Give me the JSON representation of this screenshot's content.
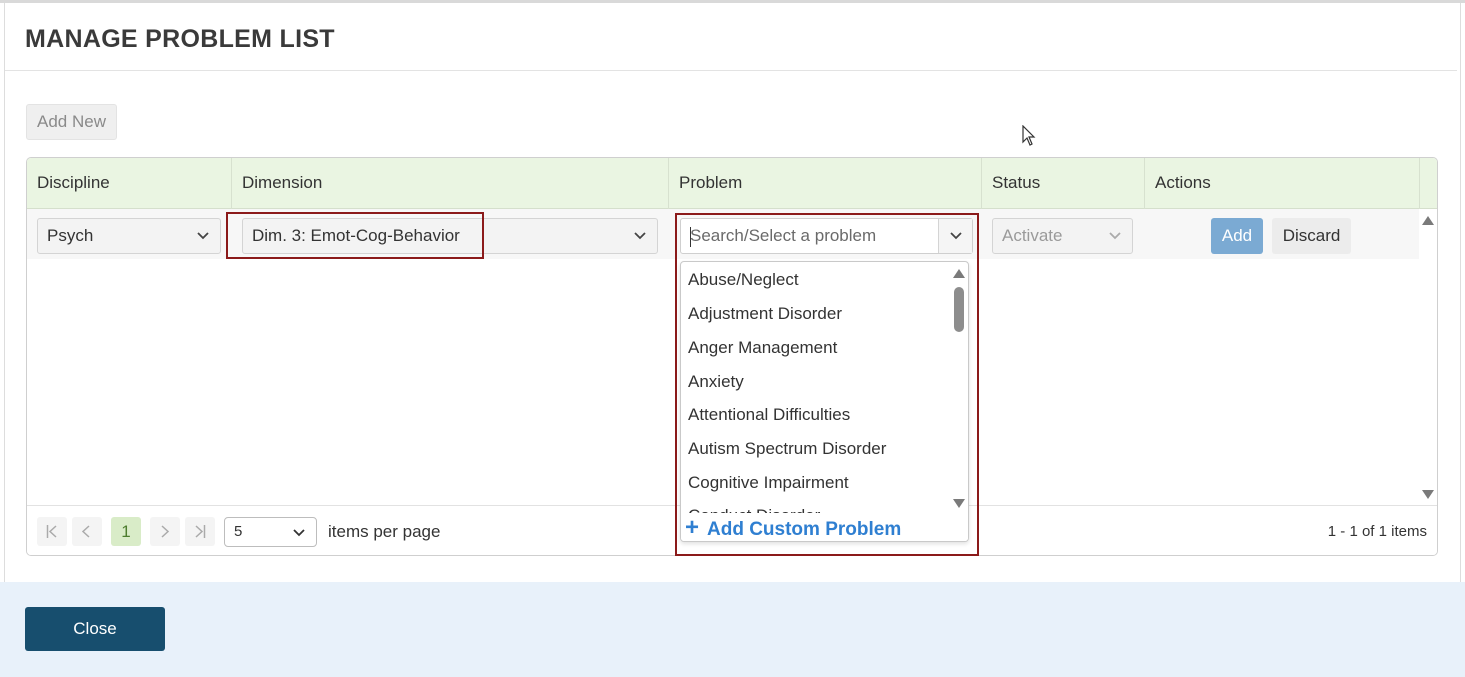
{
  "dialog": {
    "title": "MANAGE PROBLEM LIST"
  },
  "toolbar": {
    "add_new_label": "Add New"
  },
  "grid": {
    "columns": [
      "Discipline",
      "Dimension",
      "Problem",
      "Status",
      "Actions"
    ],
    "edit_row": {
      "discipline_value": "Psych",
      "dimension_value": "Dim. 3: Emot-Cog-Behavior",
      "problem_placeholder": "Search/Select a problem",
      "status_value": "Activate",
      "add_label": "Add",
      "discard_label": "Discard"
    }
  },
  "problem_dropdown": {
    "options": [
      "Abuse/Neglect",
      "Adjustment Disorder",
      "Anger Management",
      "Anxiety",
      "Attentional Difficulties",
      "Autism Spectrum Disorder",
      "Cognitive Impairment",
      "Conduct Disorder"
    ],
    "add_custom_label": "Add Custom Problem"
  },
  "pager": {
    "current_page": "1",
    "page_size": "5",
    "items_per_page_label": "items per page",
    "info": "1 - 1 of 1 items"
  },
  "footer": {
    "close_label": "Close"
  },
  "colors": {
    "header_bg": "#eaf5e2",
    "highlight": "#8b1a1a",
    "add_button": "#7baad3",
    "close_button": "#174e6e",
    "link_blue": "#2f7fd1",
    "footer_bg": "#e8f1fa"
  }
}
